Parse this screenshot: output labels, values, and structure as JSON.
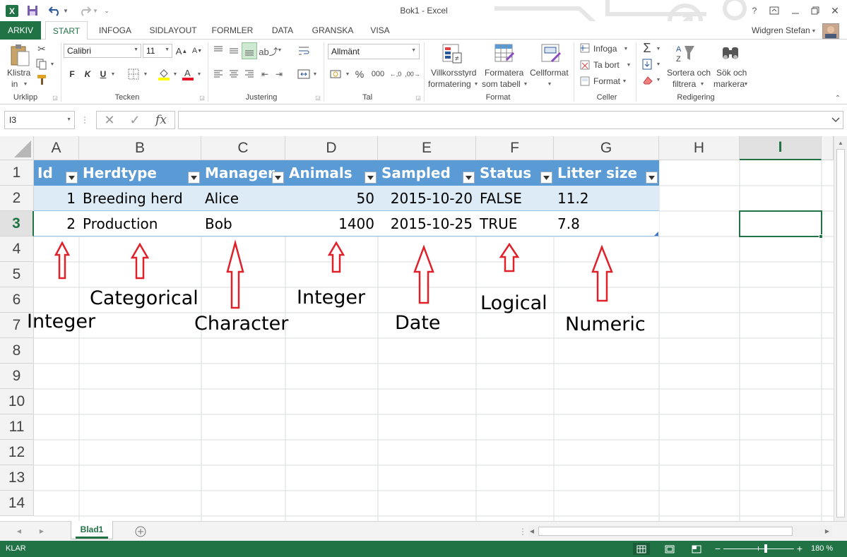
{
  "window": {
    "title": "Bok1 - Excel",
    "user": "Widgren Stefan"
  },
  "tabs": [
    {
      "label": "ARKIV"
    },
    {
      "label": "START"
    },
    {
      "label": "INFOGA"
    },
    {
      "label": "SIDLAYOUT"
    },
    {
      "label": "FORMLER"
    },
    {
      "label": "DATA"
    },
    {
      "label": "GRANSKA"
    },
    {
      "label": "VISA"
    }
  ],
  "ribbon": {
    "clipboard": {
      "paste_line1": "Klistra",
      "paste_line2": "in",
      "group": "Urklipp"
    },
    "font": {
      "family": "Calibri",
      "size": "11",
      "bold": "F",
      "italic": "K",
      "underline": "U",
      "group": "Tecken"
    },
    "alignment": {
      "group": "Justering"
    },
    "number": {
      "format": "Allmänt",
      "percent": "%",
      "thousands": "000",
      "group": "Tal"
    },
    "styles": {
      "conditional_line1": "Villkorsstyrd",
      "conditional_line2": "formatering",
      "table_line1": "Formatera",
      "table_line2": "som tabell",
      "cellstyle_line1": "Cellformat",
      "group": "Format"
    },
    "cells": {
      "insert": "Infoga",
      "delete": "Ta bort",
      "format": "Format",
      "group": "Celler"
    },
    "editing": {
      "sort_line1": "Sortera och",
      "sort_line2": "filtrera",
      "find_line1": "Sök och",
      "find_line2": "markera",
      "group": "Redigering"
    }
  },
  "formula_bar": {
    "name_box": "I3",
    "fx": "fx",
    "value": ""
  },
  "columns": [
    "A",
    "B",
    "C",
    "D",
    "E",
    "F",
    "G",
    "H",
    "I"
  ],
  "rows": [
    "1",
    "2",
    "3",
    "4",
    "5",
    "6",
    "7",
    "8",
    "9",
    "10",
    "11",
    "12",
    "13",
    "14"
  ],
  "table": {
    "headers": [
      "Id",
      "Herdtype",
      "Manager",
      "Animals",
      "Sampled",
      "Status",
      "Litter size"
    ],
    "rows": [
      [
        "1",
        "Breeding herd",
        "Alice",
        "50",
        "2015-10-20",
        "FALSE",
        "11.2"
      ],
      [
        "2",
        "Production",
        "Bob",
        "1400",
        "2015-10-25",
        "TRUE",
        "7.8"
      ]
    ]
  },
  "annotations": {
    "id": "Integer",
    "herdtype": "Categorical",
    "manager": "Character",
    "animals": "Integer",
    "sampled": "Date",
    "status": "Logical",
    "litter": "Numeric"
  },
  "sheets": [
    {
      "label": "Blad1"
    }
  ],
  "status": {
    "mode": "KLAR",
    "zoom": "180 %"
  },
  "colors": {
    "excel_green": "#217346",
    "table_header": "#5b9bd5",
    "table_band": "#ddebf7",
    "arrow": "#e0202a"
  }
}
